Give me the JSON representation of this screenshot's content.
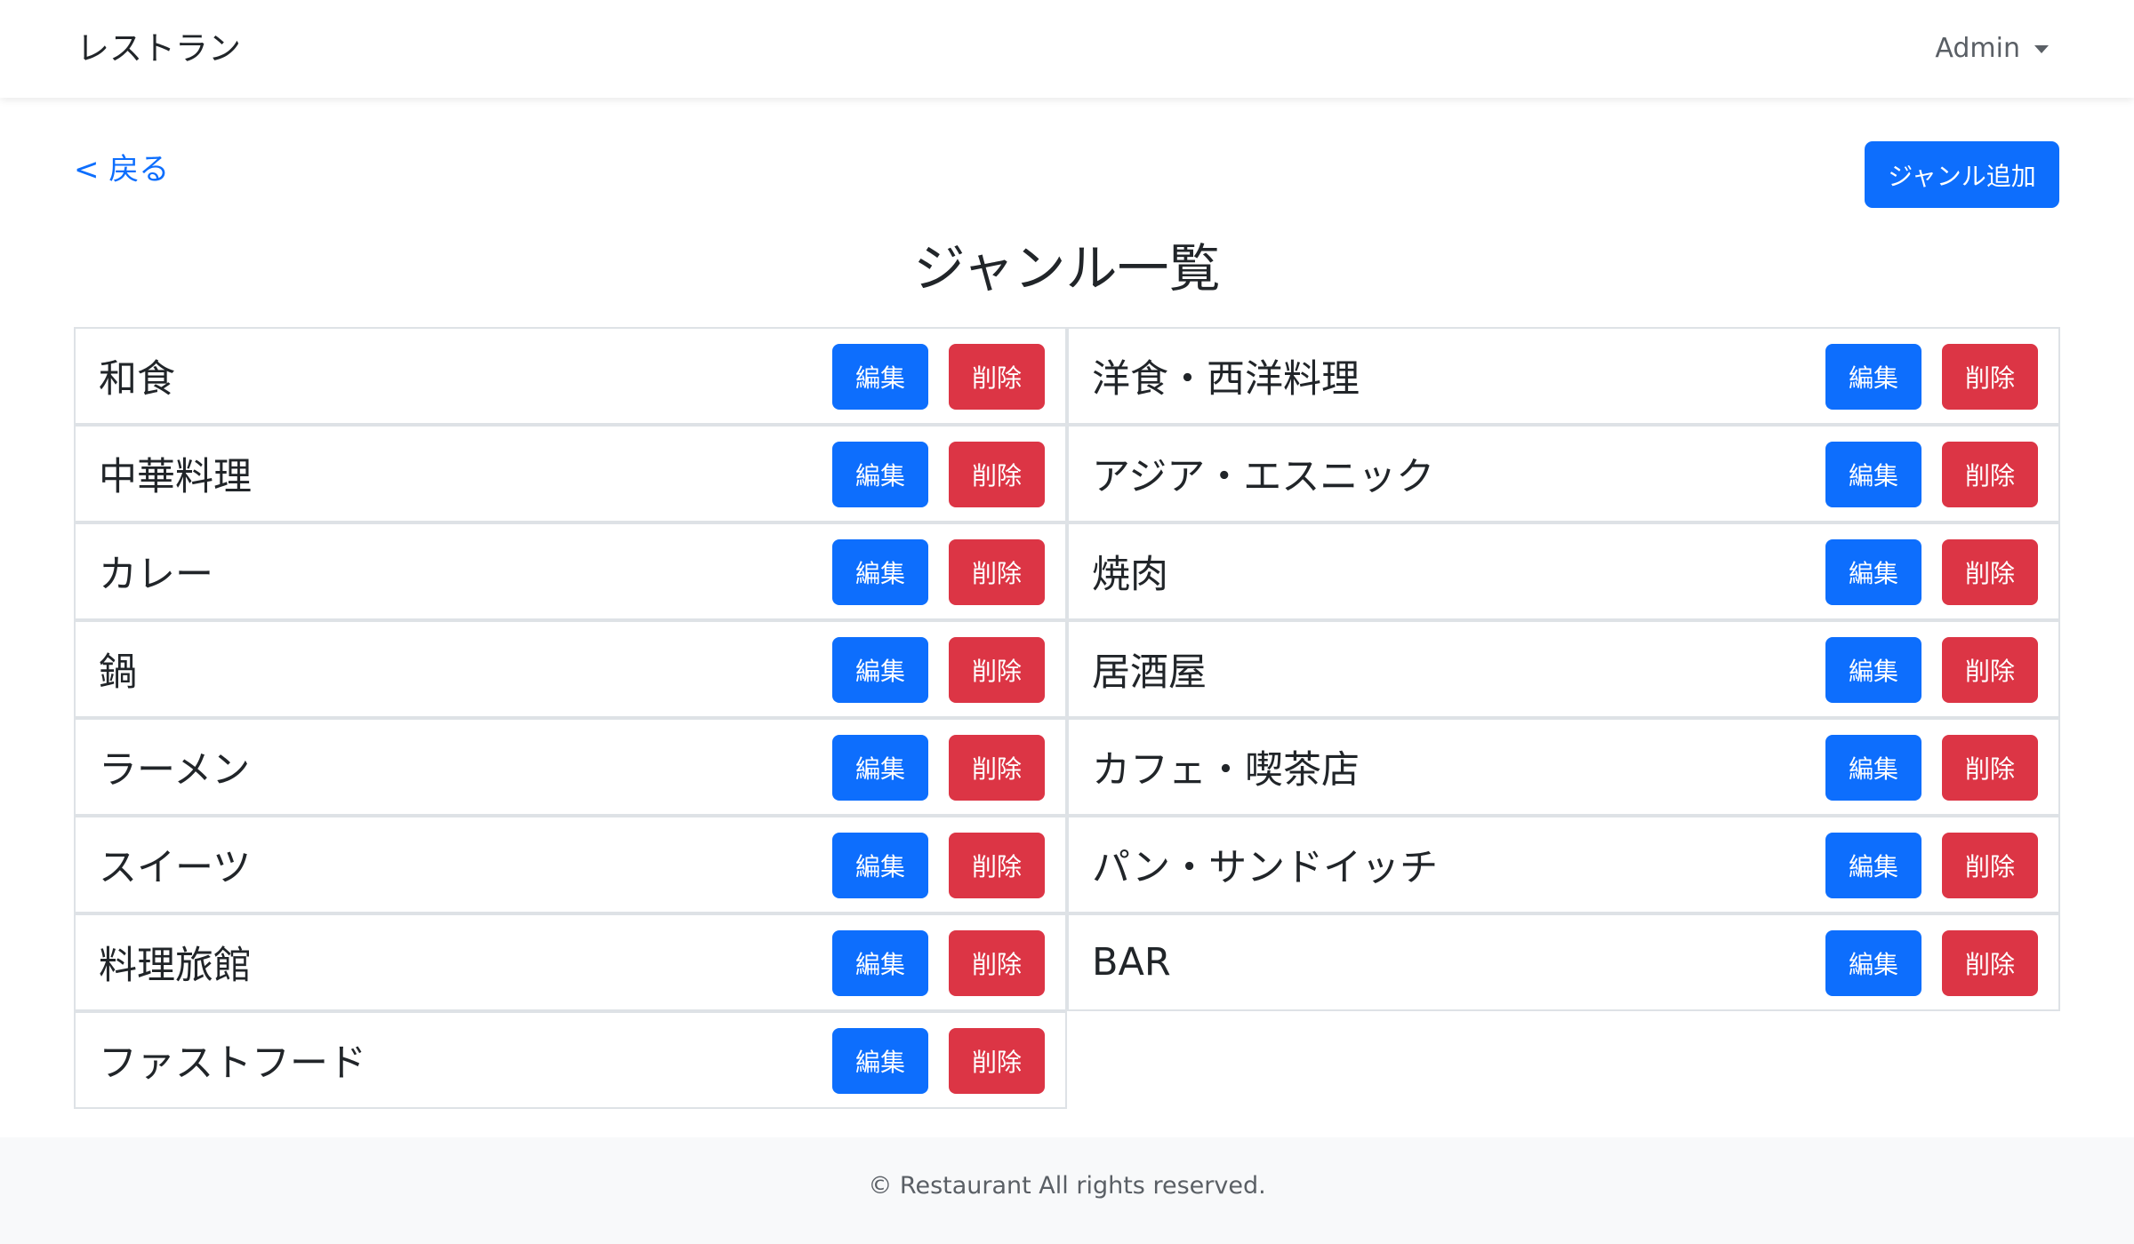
{
  "navbar": {
    "brand": "レストラン",
    "user_menu": "Admin"
  },
  "actions": {
    "back_label": "< 戻る",
    "add_label": "ジャンル追加"
  },
  "page_title": "ジャンル一覧",
  "genre_list": {
    "edit_label": "編集",
    "delete_label": "削除",
    "left_column": [
      "和食",
      "中華料理",
      "カレー",
      "鍋",
      "ラーメン",
      "スイーツ",
      "料理旅館",
      "ファストフード"
    ],
    "right_column": [
      "洋食・西洋料理",
      "アジア・エスニック",
      "焼肉",
      "居酒屋",
      "カフェ・喫茶店",
      "パン・サンドイッチ",
      "BAR"
    ]
  },
  "footer": {
    "text": "© Restaurant All rights reserved."
  },
  "colors": {
    "primary": "#0d6efd",
    "danger": "#dc3545",
    "border": "#dee2e6",
    "footer_bg": "#f8f9fa"
  }
}
